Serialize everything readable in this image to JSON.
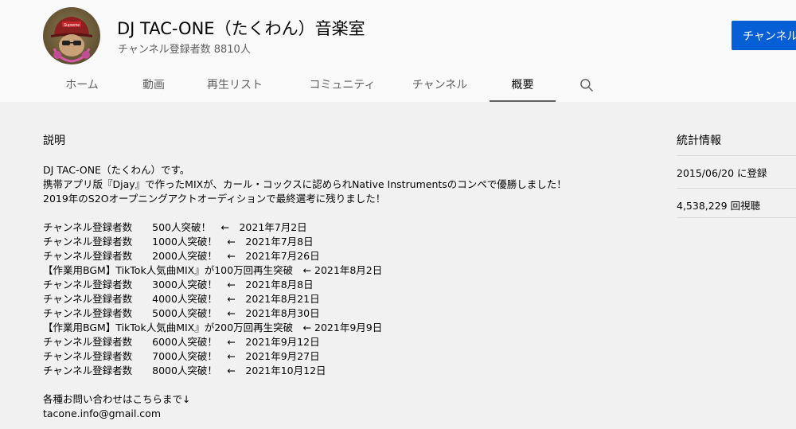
{
  "channel": {
    "title": "DJ TAC-ONE（たくわん）音楽室",
    "subscribers": "チャンネル登録者数 8810人",
    "subscribe_label": "チャンネル登録",
    "avatar_cap_text": "Supreme"
  },
  "tabs": [
    {
      "label": "ホーム"
    },
    {
      "label": "動画"
    },
    {
      "label": "再生リスト"
    },
    {
      "label": "コミュニティ"
    },
    {
      "label": "チャンネル"
    },
    {
      "label": "概要",
      "active": true
    }
  ],
  "search": {
    "icon": "search-icon"
  },
  "description": {
    "heading": "説明",
    "lines": [
      "DJ TAC-ONE（たくわん）です。",
      "携帯アプリ版『Djay』で作ったMIXが、カール・コックスに認められNative Instrumentsのコンペで優勝しました！",
      "2019年のS2Oオープニングアクトオーディションで最終選考に残りました！",
      "",
      "チャンネル登録者数　　500人突破！　←　2021年7月2日",
      "チャンネル登録者数　　1000人突破！　←　2021年7月8日",
      "チャンネル登録者数　　2000人突破！　←　2021年7月26日",
      "【作業用BGM】TikTok人気曲MIX』が100万回再生突破　← 2021年8月2日",
      "チャンネル登録者数　　3000人突破！　←　2021年8月8日",
      "チャンネル登録者数　　4000人突破！　←　2021年8月21日",
      "チャンネル登録者数　　5000人突破！　←　2021年8月30日",
      "【作業用BGM】TikTok人気曲MIX』が200万回再生突破　← 2021年9月9日",
      "チャンネル登録者数　　6000人突破！　←　2021年9月12日",
      "チャンネル登録者数　　7000人突破！　←　2021年9月27日",
      "チャンネル登録者数　　8000人突破！　←　2021年10月12日",
      "",
      "各種お問い合わせはこちらまで↓",
      "tacone.info@gmail.com"
    ]
  },
  "stats": {
    "heading": "統計情報",
    "joined": "2015/06/20 に登録",
    "views": "4,538,229 回視聴"
  },
  "colors": {
    "accent": "#065fd4",
    "header_bg": "#f9f9f9",
    "page_bg": "#f1f1f1"
  }
}
